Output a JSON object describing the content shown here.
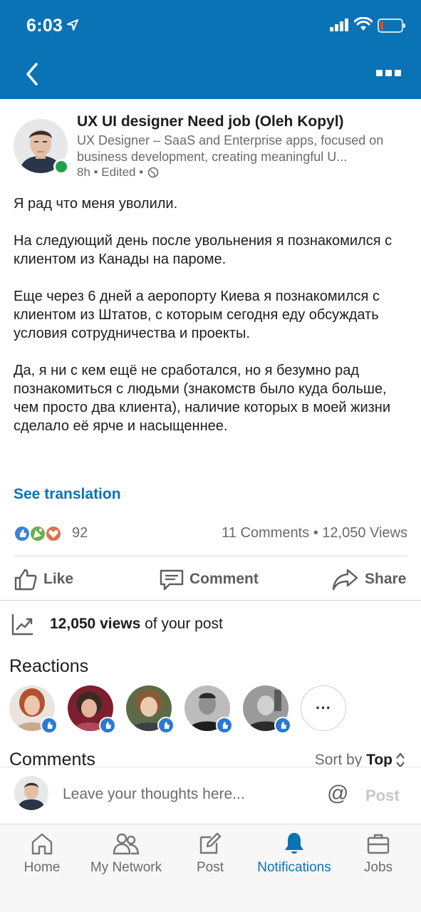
{
  "status_bar": {
    "time": "6:03"
  },
  "post": {
    "author_name": "UX UI designer Need job (Oleh Kopyl)",
    "headline": "UX Designer – SaaS and Enterprise apps, focused on business development, creating meaningful U...",
    "meta": "8h • Edited •",
    "paragraphs": [
      "Я рад что меня уволили.",
      "На следующий день после увольнения я познакомился с клиентом из Канады на пароме.",
      "Еще через 6 дней а аеропорту Киева я познакомился с клиентом из Штатов, с которым сегодня еду обсуждать условия сотрудничества и проекты.",
      "Да, я ни с кем ещё не сработался, но я безумно рад познакомиться с людьми (знакомств было куда больше, чем просто два клиента), наличие которых в моей жизни сделало её ярче и насыщеннее."
    ],
    "see_translation": "See translation",
    "reaction_count": "92",
    "comments_views": "11 Comments  •  12,050 Views"
  },
  "actions": {
    "like": "Like",
    "comment": "Comment",
    "share": "Share"
  },
  "views": {
    "count": "12,050 views",
    "suffix": " of your post"
  },
  "reactions": {
    "title": "Reactions",
    "more": "···"
  },
  "comments": {
    "title": "Comments",
    "sort_prefix": "Sort by ",
    "sort_value": "Top"
  },
  "composer": {
    "placeholder": "Leave your thoughts here...",
    "at": "@",
    "post": "Post"
  },
  "tabs": [
    {
      "label": "Home",
      "icon": "home-icon"
    },
    {
      "label": "My Network",
      "icon": "my-network-icon"
    },
    {
      "label": "Post",
      "icon": "post-icon"
    },
    {
      "label": "Notifications",
      "icon": "notifications-icon",
      "active": true
    },
    {
      "label": "Jobs",
      "icon": "jobs-icon"
    }
  ],
  "colors": {
    "brand": "#0a73b5",
    "online": "#1fa14b",
    "like_badge": "#2b7ad1"
  }
}
